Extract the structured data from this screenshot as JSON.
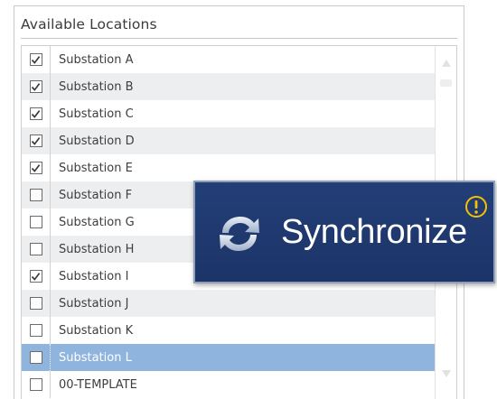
{
  "panel": {
    "title": "Available Locations"
  },
  "locations": [
    {
      "label": "Substation A",
      "checked": true,
      "selected": false
    },
    {
      "label": "Substation B",
      "checked": true,
      "selected": false
    },
    {
      "label": "Substation C",
      "checked": true,
      "selected": false
    },
    {
      "label": "Substation D",
      "checked": true,
      "selected": false
    },
    {
      "label": "Substation E",
      "checked": true,
      "selected": false
    },
    {
      "label": "Substation F",
      "checked": false,
      "selected": false
    },
    {
      "label": "Substation G",
      "checked": false,
      "selected": false
    },
    {
      "label": "Substation H",
      "checked": false,
      "selected": false
    },
    {
      "label": "Substation I",
      "checked": true,
      "selected": false
    },
    {
      "label": "Substation J",
      "checked": false,
      "selected": false
    },
    {
      "label": "Substation K",
      "checked": false,
      "selected": false
    },
    {
      "label": "Substation L",
      "checked": false,
      "selected": true
    },
    {
      "label": "00-TEMPLATE",
      "checked": false,
      "selected": false
    }
  ],
  "sync_button": {
    "label": "Synchronize",
    "icon": "sync-arrows-icon",
    "badge_icon": "alert-icon"
  },
  "colors": {
    "selected_row": "#8fb5df",
    "alt_row": "#eceef0",
    "sync_background": "#1f3a70",
    "alert": "#f2c100"
  }
}
